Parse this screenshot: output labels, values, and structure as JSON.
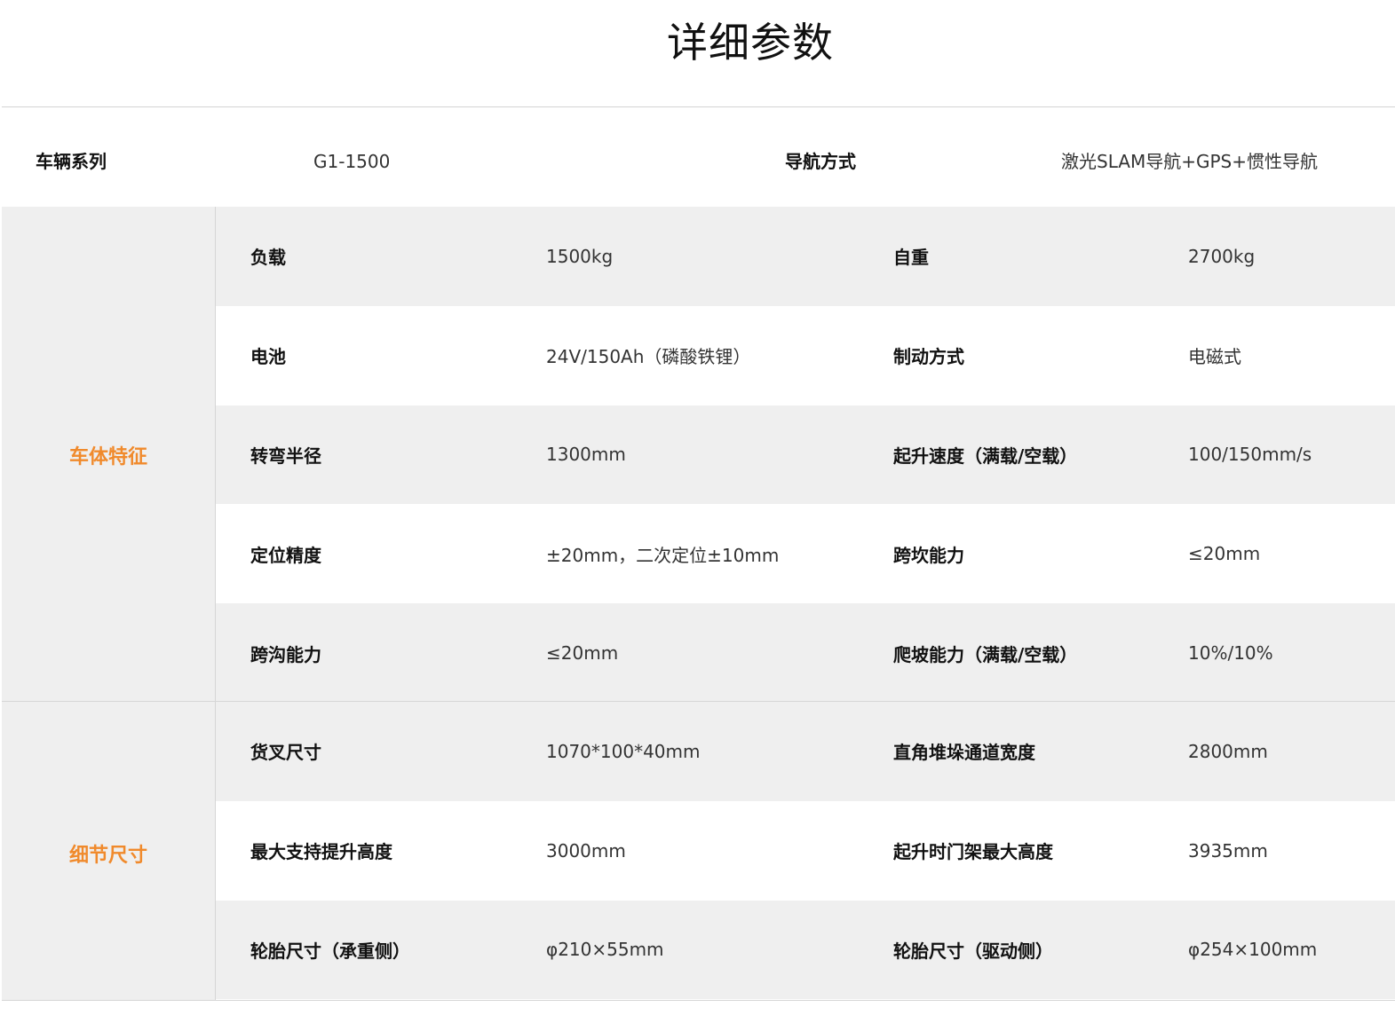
{
  "title": "详细参数",
  "series": {
    "label1": "车辆系列",
    "value1": "G1-1500",
    "label2": "导航方式",
    "value2": "激光SLAM导航+GPS+惯性导航"
  },
  "sections": [
    {
      "name": "车体特征",
      "rows": [
        [
          "负载",
          "1500kg",
          "自重",
          "2700kg"
        ],
        [
          "电池",
          "24V/150Ah（磷酸铁锂）",
          "制动方式",
          "电磁式"
        ],
        [
          "转弯半径",
          "1300mm",
          "起升速度（满载/空载）",
          "100/150mm/s"
        ],
        [
          "定位精度",
          "±20mm，二次定位±10mm",
          "跨坎能力",
          "≤20mm"
        ],
        [
          "跨沟能力",
          "≤20mm",
          "爬坡能力（满载/空载）",
          "10%/10%"
        ]
      ]
    },
    {
      "name": "细节尺寸",
      "rows": [
        [
          "货叉尺寸",
          "1070*100*40mm",
          "直角堆垛通道宽度",
          "2800mm"
        ],
        [
          "最大支持提升高度",
          "3000mm",
          "起升时门架最大高度",
          "3935mm"
        ],
        [
          "轮胎尺寸（承重侧）",
          "φ210×55mm",
          "轮胎尺寸（驱动侧）",
          "φ254×100mm"
        ]
      ]
    }
  ]
}
